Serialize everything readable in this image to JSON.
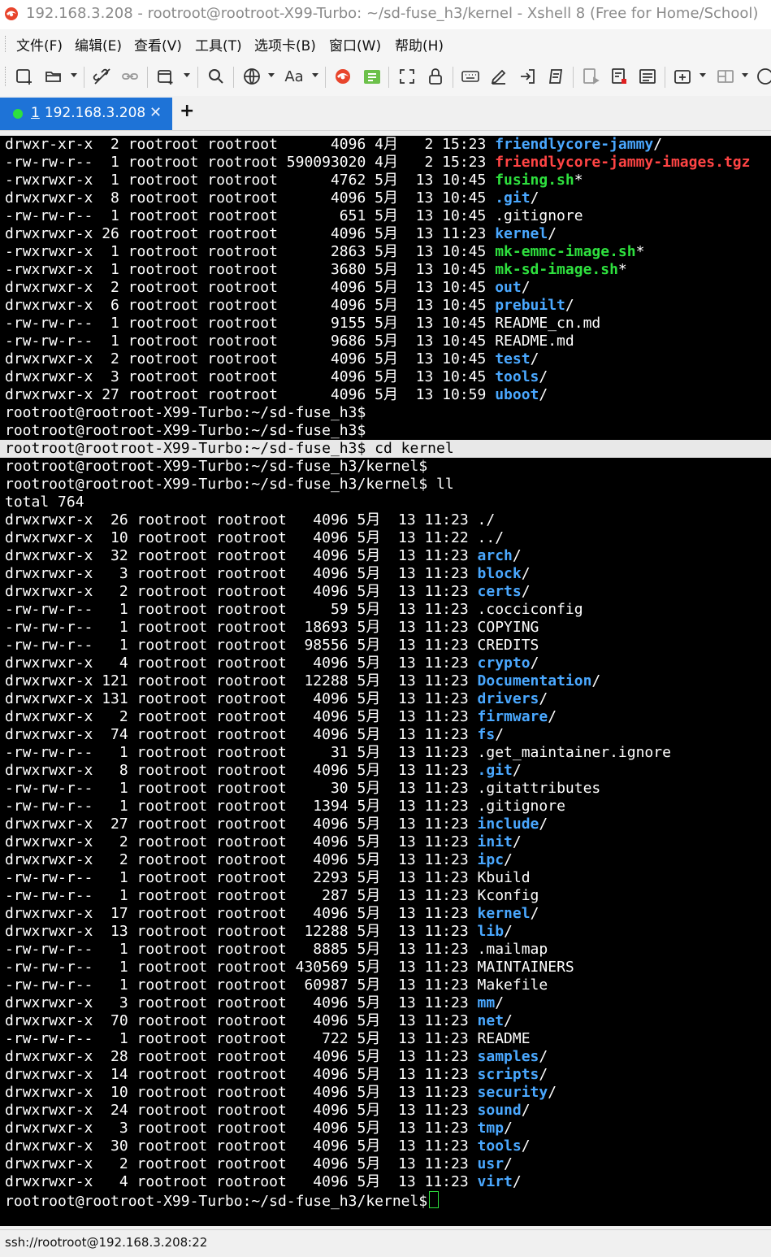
{
  "window": {
    "title": "192.168.3.208 - rootroot@rootroot-X99-Turbo: ~/sd-fuse_h3/kernel - Xshell 8 (Free for Home/School)"
  },
  "menu": [
    "文件(F)",
    "编辑(E)",
    "查看(V)",
    "工具(T)",
    "选项卡(B)",
    "窗口(W)",
    "帮助(H)"
  ],
  "toolbar": {
    "icons": [
      "new-session-icon",
      "open-folder-icon",
      "disconnect-icon",
      "reconnect-icon",
      "new-window-icon",
      "search-icon",
      "globe-icon",
      "font-icon",
      "xshell-logo-icon",
      "xftp-icon",
      "fullscreen-icon",
      "lock-icon",
      "keyboard-icon",
      "pen-icon",
      "send-icon",
      "script-icon",
      "log-icon",
      "record-icon",
      "compose-icon",
      "add-tab-icon",
      "layout-icon",
      "help-icon"
    ]
  },
  "tabs": [
    {
      "number": "1",
      "label": "192.168.3.208",
      "status_color": "#2ee03e",
      "active": true
    }
  ],
  "new_tab_label": "+",
  "terminal": {
    "lines": [
      {
        "text": "drwxr-xr-x  2 rootroot rootroot      4096 4月   2 15:23 ",
        "name": "friendlycore-jammy",
        "type": "dir",
        "suffix": "/"
      },
      {
        "text": "-rw-rw-r--  1 rootroot rootroot 590093020 4月   2 15:23 ",
        "name": "friendlycore-jammy-images.tgz",
        "type": "arc",
        "suffix": ""
      },
      {
        "text": "-rwxrwxr-x  1 rootroot rootroot      4762 5月  13 10:45 ",
        "name": "fusing.sh",
        "type": "exe",
        "suffix": "*"
      },
      {
        "text": "drwxrwxr-x  8 rootroot rootroot      4096 5月  13 10:45 ",
        "name": ".git",
        "type": "dir",
        "suffix": "/"
      },
      {
        "text": "-rw-rw-r--  1 rootroot rootroot       651 5月  13 10:45 ",
        "name": ".gitignore",
        "type": "plain",
        "suffix": ""
      },
      {
        "text": "drwxrwxr-x 26 rootroot rootroot      4096 5月  13 11:23 ",
        "name": "kernel",
        "type": "dir",
        "suffix": "/"
      },
      {
        "text": "-rwxrwxr-x  1 rootroot rootroot      2863 5月  13 10:45 ",
        "name": "mk-emmc-image.sh",
        "type": "exe",
        "suffix": "*"
      },
      {
        "text": "-rwxrwxr-x  1 rootroot rootroot      3680 5月  13 10:45 ",
        "name": "mk-sd-image.sh",
        "type": "exe",
        "suffix": "*"
      },
      {
        "text": "drwxrwxr-x  2 rootroot rootroot      4096 5月  13 10:45 ",
        "name": "out",
        "type": "dir",
        "suffix": "/"
      },
      {
        "text": "drwxrwxr-x  6 rootroot rootroot      4096 5月  13 10:45 ",
        "name": "prebuilt",
        "type": "dir",
        "suffix": "/"
      },
      {
        "text": "-rw-rw-r--  1 rootroot rootroot      9155 5月  13 10:45 ",
        "name": "README_cn.md",
        "type": "plain",
        "suffix": ""
      },
      {
        "text": "-rw-rw-r--  1 rootroot rootroot      9686 5月  13 10:45 ",
        "name": "README.md",
        "type": "plain",
        "suffix": ""
      },
      {
        "text": "drwxrwxr-x  2 rootroot rootroot      4096 5月  13 10:45 ",
        "name": "test",
        "type": "dir",
        "suffix": "/"
      },
      {
        "text": "drwxrwxr-x  3 rootroot rootroot      4096 5月  13 10:45 ",
        "name": "tools",
        "type": "dir",
        "suffix": "/"
      },
      {
        "text": "drwxrwxr-x 27 rootroot rootroot      4096 5月  13 10:59 ",
        "name": "uboot",
        "type": "dir",
        "suffix": "/"
      },
      {
        "text": "rootroot@rootroot-X99-Turbo:~/sd-fuse_h3$",
        "name": "",
        "type": "plain",
        "suffix": ""
      },
      {
        "text": "rootroot@rootroot-X99-Turbo:~/sd-fuse_h3$",
        "name": "",
        "type": "plain",
        "suffix": ""
      },
      {
        "text": "rootroot@rootroot-X99-Turbo:~/sd-fuse_h3$ cd kernel",
        "name": "",
        "type": "plain",
        "suffix": "",
        "highlight": true
      },
      {
        "text": "rootroot@rootroot-X99-Turbo:~/sd-fuse_h3/kernel$",
        "name": "",
        "type": "plain",
        "suffix": ""
      },
      {
        "text": "rootroot@rootroot-X99-Turbo:~/sd-fuse_h3/kernel$ ll",
        "name": "",
        "type": "plain",
        "suffix": ""
      },
      {
        "text": "total 764",
        "name": "",
        "type": "plain",
        "suffix": ""
      },
      {
        "text": "drwxrwxr-x  26 rootroot rootroot   4096 5月  13 11:23 ",
        "name": "./",
        "type": "plain",
        "suffix": ""
      },
      {
        "text": "drwxrwxr-x  10 rootroot rootroot   4096 5月  13 11:22 ",
        "name": "../",
        "type": "plain",
        "suffix": ""
      },
      {
        "text": "drwxrwxr-x  32 rootroot rootroot   4096 5月  13 11:23 ",
        "name": "arch",
        "type": "dir",
        "suffix": "/"
      },
      {
        "text": "drwxrwxr-x   3 rootroot rootroot   4096 5月  13 11:23 ",
        "name": "block",
        "type": "dir",
        "suffix": "/"
      },
      {
        "text": "drwxrwxr-x   2 rootroot rootroot   4096 5月  13 11:23 ",
        "name": "certs",
        "type": "dir",
        "suffix": "/"
      },
      {
        "text": "-rw-rw-r--   1 rootroot rootroot     59 5月  13 11:23 ",
        "name": ".cocciconfig",
        "type": "plain",
        "suffix": ""
      },
      {
        "text": "-rw-rw-r--   1 rootroot rootroot  18693 5月  13 11:23 ",
        "name": "COPYING",
        "type": "plain",
        "suffix": ""
      },
      {
        "text": "-rw-rw-r--   1 rootroot rootroot  98556 5月  13 11:23 ",
        "name": "CREDITS",
        "type": "plain",
        "suffix": ""
      },
      {
        "text": "drwxrwxr-x   4 rootroot rootroot   4096 5月  13 11:23 ",
        "name": "crypto",
        "type": "dir",
        "suffix": "/"
      },
      {
        "text": "drwxrwxr-x 121 rootroot rootroot  12288 5月  13 11:23 ",
        "name": "Documentation",
        "type": "dir",
        "suffix": "/"
      },
      {
        "text": "drwxrwxr-x 131 rootroot rootroot   4096 5月  13 11:23 ",
        "name": "drivers",
        "type": "dir",
        "suffix": "/"
      },
      {
        "text": "drwxrwxr-x   2 rootroot rootroot   4096 5月  13 11:23 ",
        "name": "firmware",
        "type": "dir",
        "suffix": "/"
      },
      {
        "text": "drwxrwxr-x  74 rootroot rootroot   4096 5月  13 11:23 ",
        "name": "fs",
        "type": "dir",
        "suffix": "/"
      },
      {
        "text": "-rw-rw-r--   1 rootroot rootroot     31 5月  13 11:23 ",
        "name": ".get_maintainer.ignore",
        "type": "plain",
        "suffix": ""
      },
      {
        "text": "drwxrwxr-x   8 rootroot rootroot   4096 5月  13 11:23 ",
        "name": ".git",
        "type": "dir",
        "suffix": "/"
      },
      {
        "text": "-rw-rw-r--   1 rootroot rootroot     30 5月  13 11:23 ",
        "name": ".gitattributes",
        "type": "plain",
        "suffix": ""
      },
      {
        "text": "-rw-rw-r--   1 rootroot rootroot   1394 5月  13 11:23 ",
        "name": ".gitignore",
        "type": "plain",
        "suffix": ""
      },
      {
        "text": "drwxrwxr-x  27 rootroot rootroot   4096 5月  13 11:23 ",
        "name": "include",
        "type": "dir",
        "suffix": "/"
      },
      {
        "text": "drwxrwxr-x   2 rootroot rootroot   4096 5月  13 11:23 ",
        "name": "init",
        "type": "dir",
        "suffix": "/"
      },
      {
        "text": "drwxrwxr-x   2 rootroot rootroot   4096 5月  13 11:23 ",
        "name": "ipc",
        "type": "dir",
        "suffix": "/"
      },
      {
        "text": "-rw-rw-r--   1 rootroot rootroot   2293 5月  13 11:23 ",
        "name": "Kbuild",
        "type": "plain",
        "suffix": ""
      },
      {
        "text": "-rw-rw-r--   1 rootroot rootroot    287 5月  13 11:23 ",
        "name": "Kconfig",
        "type": "plain",
        "suffix": ""
      },
      {
        "text": "drwxrwxr-x  17 rootroot rootroot   4096 5月  13 11:23 ",
        "name": "kernel",
        "type": "dir",
        "suffix": "/"
      },
      {
        "text": "drwxrwxr-x  13 rootroot rootroot  12288 5月  13 11:23 ",
        "name": "lib",
        "type": "dir",
        "suffix": "/"
      },
      {
        "text": "-rw-rw-r--   1 rootroot rootroot   8885 5月  13 11:23 ",
        "name": ".mailmap",
        "type": "plain",
        "suffix": ""
      },
      {
        "text": "-rw-rw-r--   1 rootroot rootroot 430569 5月  13 11:23 ",
        "name": "MAINTAINERS",
        "type": "plain",
        "suffix": ""
      },
      {
        "text": "-rw-rw-r--   1 rootroot rootroot  60987 5月  13 11:23 ",
        "name": "Makefile",
        "type": "plain",
        "suffix": ""
      },
      {
        "text": "drwxrwxr-x   3 rootroot rootroot   4096 5月  13 11:23 ",
        "name": "mm",
        "type": "dir",
        "suffix": "/"
      },
      {
        "text": "drwxrwxr-x  70 rootroot rootroot   4096 5月  13 11:23 ",
        "name": "net",
        "type": "dir",
        "suffix": "/"
      },
      {
        "text": "-rw-rw-r--   1 rootroot rootroot    722 5月  13 11:23 ",
        "name": "README",
        "type": "plain",
        "suffix": ""
      },
      {
        "text": "drwxrwxr-x  28 rootroot rootroot   4096 5月  13 11:23 ",
        "name": "samples",
        "type": "dir",
        "suffix": "/"
      },
      {
        "text": "drwxrwxr-x  14 rootroot rootroot   4096 5月  13 11:23 ",
        "name": "scripts",
        "type": "dir",
        "suffix": "/"
      },
      {
        "text": "drwxrwxr-x  10 rootroot rootroot   4096 5月  13 11:23 ",
        "name": "security",
        "type": "dir",
        "suffix": "/"
      },
      {
        "text": "drwxrwxr-x  24 rootroot rootroot   4096 5月  13 11:23 ",
        "name": "sound",
        "type": "dir",
        "suffix": "/"
      },
      {
        "text": "drwxrwxr-x   3 rootroot rootroot   4096 5月  13 11:23 ",
        "name": "tmp",
        "type": "dir",
        "suffix": "/"
      },
      {
        "text": "drwxrwxr-x  30 rootroot rootroot   4096 5月  13 11:23 ",
        "name": "tools",
        "type": "dir",
        "suffix": "/"
      },
      {
        "text": "drwxrwxr-x   2 rootroot rootroot   4096 5月  13 11:23 ",
        "name": "usr",
        "type": "dir",
        "suffix": "/"
      },
      {
        "text": "drwxrwxr-x   4 rootroot rootroot   4096 5月  13 11:23 ",
        "name": "virt",
        "type": "dir",
        "suffix": "/"
      },
      {
        "text": "rootroot@rootroot-X99-Turbo:~/sd-fuse_h3/kernel$",
        "name": "",
        "type": "plain",
        "suffix": "",
        "cursor": true
      }
    ]
  },
  "colors": {
    "directory": "#4aa8ff",
    "executable": "#2ee03e",
    "archive": "#ff4444",
    "tab_active": "#1e73d7"
  },
  "statusbar": {
    "connection": "ssh://rootroot@192.168.3.208:22"
  }
}
